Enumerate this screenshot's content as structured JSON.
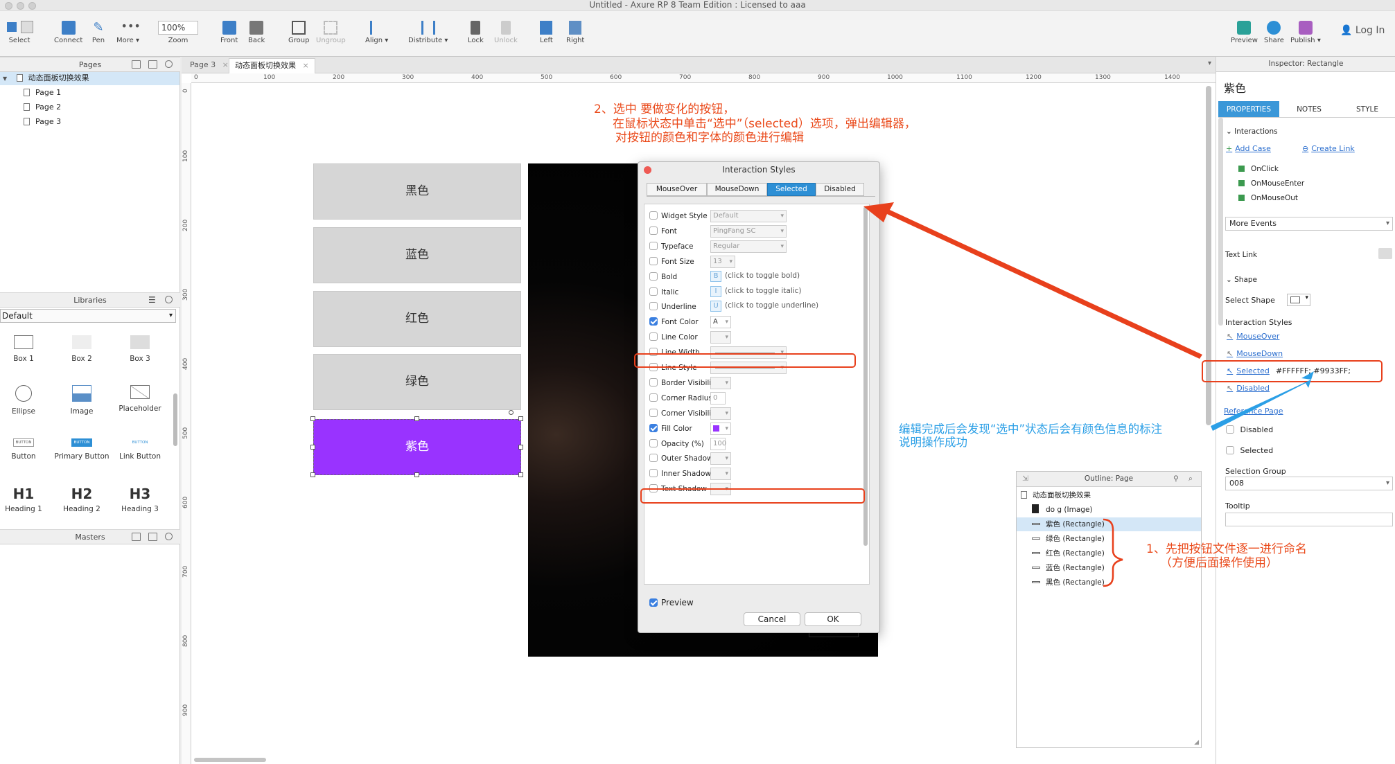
{
  "window": {
    "title": "Untitled - Axure RP 8 Team Edition : Licensed to aaa"
  },
  "toolbar": {
    "select": "Select",
    "connect": "Connect",
    "pen": "Pen",
    "more": "More ▾",
    "zoom_value": "100%",
    "zoom_label": "Zoom",
    "front": "Front",
    "back": "Back",
    "group": "Group",
    "ungroup": "Ungroup",
    "align": "Align ▾",
    "distribute": "Distribute ▾",
    "lock": "Lock",
    "unlock": "Unlock",
    "left": "Left",
    "right": "Right",
    "preview": "Preview",
    "share": "Share",
    "publish": "Publish ▾",
    "login": "Log In"
  },
  "pages_panel": {
    "title": "Pages",
    "root": "动态面板切换效果",
    "pages": [
      "Page 1",
      "Page 2",
      "Page 3"
    ]
  },
  "libraries_panel": {
    "title": "Libraries",
    "selected": "Default",
    "items": [
      "Box 1",
      "Box 2",
      "Box 3",
      "Ellipse",
      "Image",
      "Placeholder",
      "Button",
      "Primary Button",
      "Link Button",
      "Heading 1",
      "Heading 2",
      "Heading 3"
    ],
    "button_thumb_text": [
      "BUTTON",
      "BUTTON",
      "BUTTON"
    ],
    "heading_thumb_text": [
      "H1",
      "H2",
      "H3"
    ]
  },
  "masters_panel": {
    "title": "Masters"
  },
  "doc_tabs": [
    "Page 3",
    "动态面板切换效果"
  ],
  "ruler": {
    "h": [
      "0",
      "100",
      "200",
      "300",
      "400",
      "500",
      "600",
      "700",
      "800",
      "900",
      "1000",
      "1100",
      "1200",
      "1300",
      "1400"
    ],
    "v": [
      "0",
      "100",
      "200",
      "300",
      "400",
      "500",
      "600",
      "700",
      "800",
      "900"
    ]
  },
  "canvas": {
    "buttons": [
      "黑色",
      "蓝色",
      "红色",
      "绿色",
      "紫色"
    ],
    "purple": "#9933FF"
  },
  "dialog": {
    "title": "Interaction Styles",
    "tabs": [
      "MouseOver",
      "MouseDown",
      "Selected",
      "Disabled"
    ],
    "active_tab": "Selected",
    "rows": [
      {
        "label": "Widget Style",
        "value": "Default",
        "checked": false
      },
      {
        "label": "Font",
        "value": "PingFang SC",
        "checked": false
      },
      {
        "label": "Typeface",
        "value": "Regular",
        "checked": false
      },
      {
        "label": "Font Size",
        "value": "13",
        "checked": false
      },
      {
        "label": "Bold",
        "value": "(click to toggle bold)",
        "checked": false
      },
      {
        "label": "Italic",
        "value": "(click to toggle italic)",
        "checked": false
      },
      {
        "label": "Underline",
        "value": "(click to toggle underline)",
        "checked": false
      },
      {
        "label": "Font Color",
        "value": "",
        "checked": true
      },
      {
        "label": "Line Color",
        "value": "",
        "checked": false
      },
      {
        "label": "Line Width",
        "value": "",
        "checked": false
      },
      {
        "label": "Line Style",
        "value": "",
        "checked": false
      },
      {
        "label": "Border Visibility",
        "value": "",
        "checked": false
      },
      {
        "label": "Corner Radius",
        "value": "0",
        "checked": false
      },
      {
        "label": "Corner Visibility",
        "value": "",
        "checked": false
      },
      {
        "label": "Fill Color",
        "value": "",
        "checked": true
      },
      {
        "label": "Opacity (%)",
        "value": "100",
        "checked": false
      },
      {
        "label": "Outer Shadow",
        "value": "",
        "checked": false
      },
      {
        "label": "Inner Shadow",
        "value": "",
        "checked": false
      },
      {
        "label": "Text Shadow",
        "value": "",
        "checked": false
      }
    ],
    "bold_glyph": "B",
    "italic_glyph": "I",
    "underline_glyph": "U",
    "font_color_glyph": "A",
    "preview_label": "Preview",
    "cancel": "Cancel",
    "ok": "OK"
  },
  "inspector": {
    "title": "Inspector: Rectangle",
    "name": "紫色",
    "tabs": [
      "PROPERTIES",
      "NOTES",
      "STYLE"
    ],
    "interactions_label": "Interactions",
    "add_case": "Add Case",
    "create_link": "Create Link",
    "events": [
      "OnClick",
      "OnMouseEnter",
      "OnMouseOut"
    ],
    "more_events": "More Events",
    "text_link": "Text Link",
    "shape_label": "Shape",
    "select_shape": "Select Shape",
    "interaction_styles": "Interaction Styles",
    "styles": [
      "MouseOver",
      "MouseDown",
      "Selected",
      "Disabled"
    ],
    "selected_value": "#FFFFFF; #9933FF;",
    "reference_page": "Reference Page",
    "disabled": "Disabled",
    "selected": "Selected",
    "selection_group": "Selection Group",
    "selection_group_value": "008",
    "tooltip": "Tooltip"
  },
  "outline": {
    "title": "Outline: Page",
    "root": "动态面板切换效果",
    "items": [
      "do g (Image)",
      "紫色 (Rectangle)",
      "绿色 (Rectangle)",
      "红色 (Rectangle)",
      "蓝色 (Rectangle)",
      "黑色 (Rectangle)"
    ]
  },
  "annotations": {
    "step2_line1": "2、选中 要做变化的按钮，",
    "step2_line2": "在鼠标状态中单击“选中”（selected）选项，弹出编辑器，",
    "step2_line3": "对按钮的颜色和字体的颜色进行编辑",
    "result_line1": "编辑完成后会发现“选中”状态后会有颜色信息的标注",
    "result_line2": "说明操作成功",
    "step1_line1": "1、先把按钮文件逐一进行命名",
    "step1_line2": "（方便后面操作使用）"
  },
  "colors": {
    "accent_red": "#e8401c",
    "accent_blue": "#2b9fe6",
    "tab_blue": "#3a97d8"
  }
}
